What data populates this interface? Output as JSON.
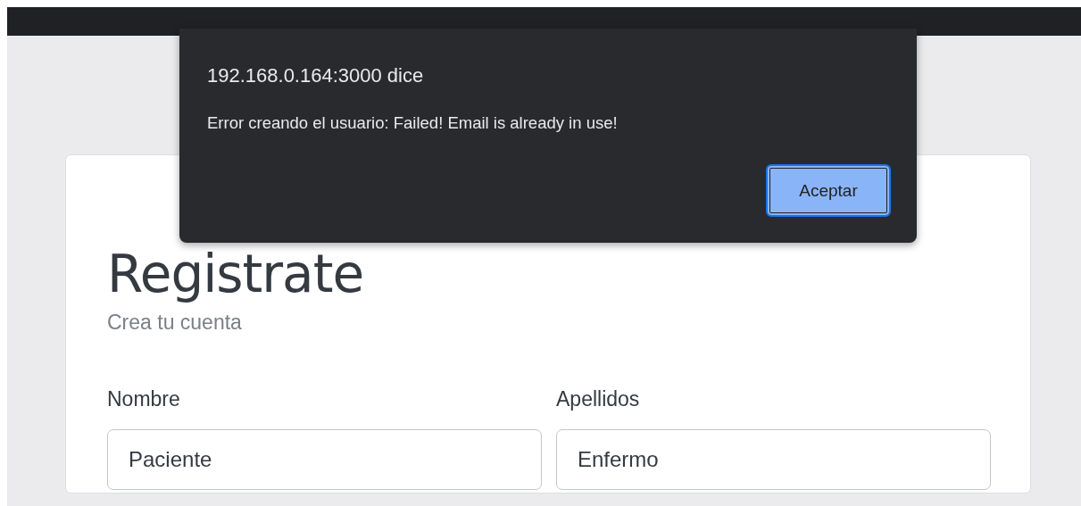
{
  "dialog": {
    "title": "192.168.0.164:3000 dice",
    "message": "Error creando el usuario: Failed! Email is already in use!",
    "button": "Aceptar"
  },
  "form": {
    "title": "Registrate",
    "subtitle": "Crea tu cuenta",
    "fields": [
      {
        "label": "Nombre",
        "value": "Paciente"
      },
      {
        "label": "Apellidos",
        "value": "Enfermo"
      }
    ]
  }
}
